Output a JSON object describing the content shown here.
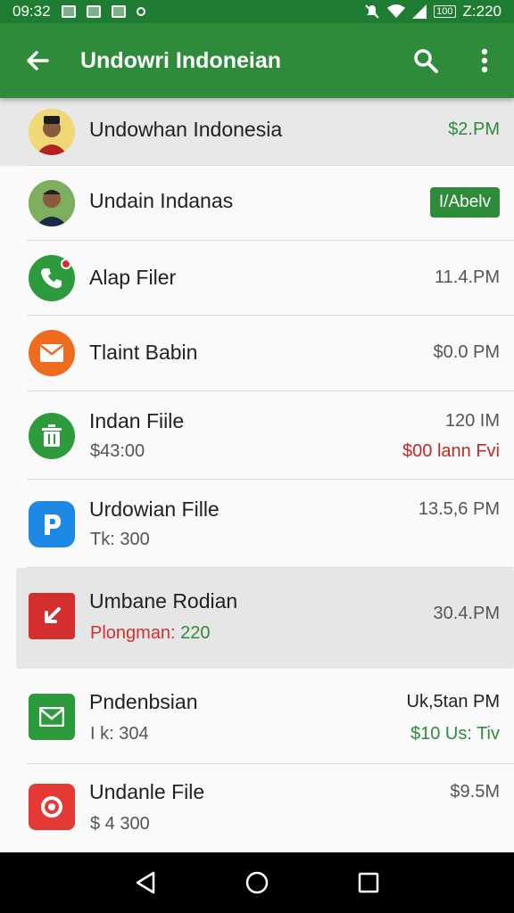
{
  "status_bar": {
    "time": "09:32",
    "battery": "100",
    "clock_right": "Z:220"
  },
  "app_bar": {
    "title": "Undowri Indoneian"
  },
  "items": [
    {
      "primary": "Undowhan Indonesia",
      "meta": "$2.PM",
      "meta_color": "#2e8b3a",
      "icon": "person-avatar-icon"
    },
    {
      "primary": "Undain Indanas",
      "badge": "I/Abelv",
      "icon": "person-avatar-icon"
    },
    {
      "primary": "Alap Filer",
      "meta": "11.4.PM",
      "icon": "phone-icon"
    },
    {
      "primary": "Tlaint Babin",
      "meta": "$0.0 PM",
      "icon": "mail-icon"
    },
    {
      "primary": "Indan Fiile",
      "secondary": "$43:00",
      "meta": "120 IM",
      "meta2": "$00 lann Fvi",
      "meta2_color": "#c62828",
      "icon": "trash-icon"
    },
    {
      "primary": "Urdowian Fille",
      "secondary": "Tk: 300",
      "meta": "13.5,6 PM",
      "icon": "app-p-icon"
    },
    {
      "primary": "Umbane Rodian",
      "secondary_a": "Plongman: ",
      "secondary_b": "220",
      "meta": "30.4.PM",
      "icon": "arrow-down-left-icon"
    },
    {
      "primary": "Pndenbsian",
      "secondary": "I k: 304",
      "meta": "Uk,5tan PM",
      "meta2": "$10 Us: Tiv",
      "meta2_color": "#2e8b3a",
      "icon": "envelope-icon"
    },
    {
      "primary": "Undanle File",
      "secondary": "$ 4 300",
      "meta": "$9.5M",
      "icon": "target-icon"
    }
  ]
}
